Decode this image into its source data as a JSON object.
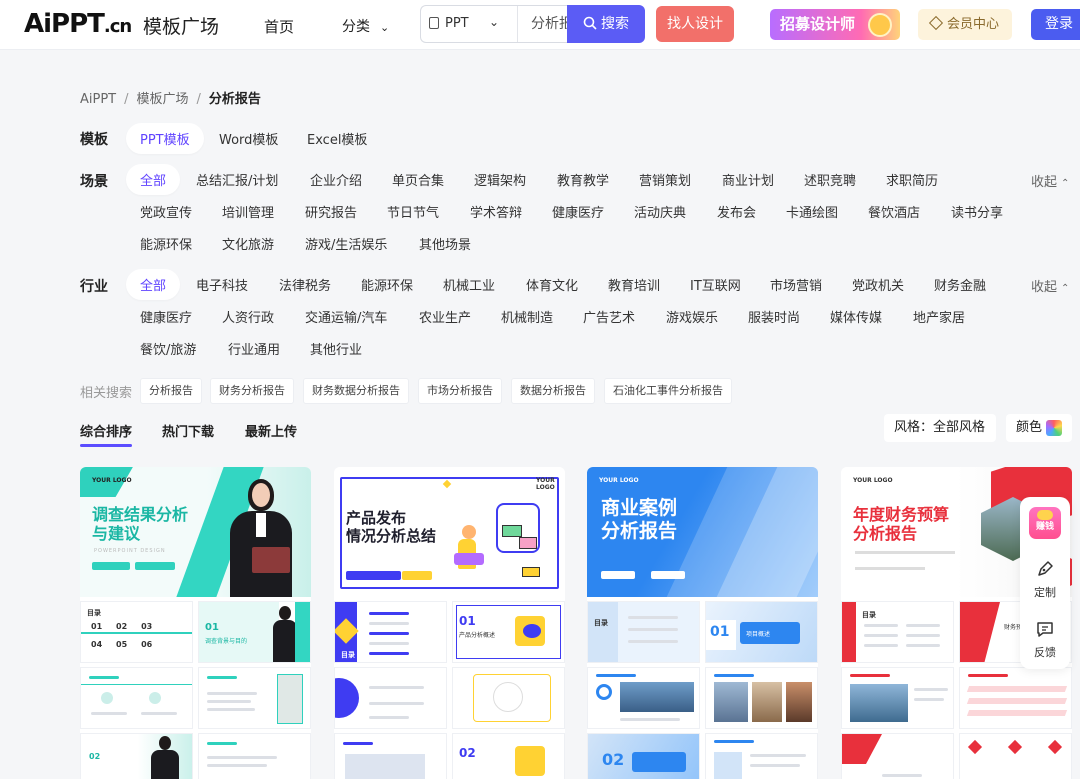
{
  "header": {
    "logo_main": "AiPPT",
    "logo_cn": ".cn",
    "logo_sub": "模板广场",
    "nav_home": "首页",
    "nav_category": "分类",
    "search_type": "PPT",
    "search_value": "分析报告",
    "search_button": "搜索",
    "designer_button": "找人设计",
    "recruit_button": "招募设计师",
    "member_button": "会员中心",
    "login_button": "登录"
  },
  "breadcrumb": [
    "AiPPT",
    "模板广场",
    "分析报告"
  ],
  "filters": {
    "template": {
      "label": "模板",
      "items": [
        "PPT模板",
        "Word模板",
        "Excel模板"
      ],
      "active": "PPT模板"
    },
    "scene": {
      "label": "场景",
      "collapse": "收起",
      "rows": [
        [
          "全部",
          "总结汇报/计划",
          "企业介绍",
          "单页合集",
          "逻辑架构",
          "教育教学",
          "营销策划",
          "商业计划",
          "述职竞聘",
          "求职简历"
        ],
        [
          "党政宣传",
          "培训管理",
          "研究报告",
          "节日节气",
          "学术答辩",
          "健康医疗",
          "活动庆典",
          "发布会",
          "卡通绘图",
          "餐饮酒店",
          "读书分享"
        ],
        [
          "能源环保",
          "文化旅游",
          "游戏/生活娱乐",
          "其他场景"
        ]
      ],
      "active": "全部"
    },
    "industry": {
      "label": "行业",
      "collapse": "收起",
      "rows": [
        [
          "全部",
          "电子科技",
          "法律税务",
          "能源环保",
          "机械工业",
          "体育文化",
          "教育培训",
          "IT互联网",
          "市场营销",
          "党政机关",
          "财务金融"
        ],
        [
          "健康医疗",
          "人资行政",
          "交通运输/汽车",
          "农业生产",
          "机械制造",
          "广告艺术",
          "游戏娱乐",
          "服装时尚",
          "媒体传媒",
          "地产家居"
        ],
        [
          "餐饮/旅游",
          "行业通用",
          "其他行业"
        ]
      ],
      "active": "全部"
    }
  },
  "related": {
    "label": "相关搜索",
    "items": [
      "分析报告",
      "财务分析报告",
      "财务数据分析报告",
      "市场分析报告",
      "数据分析报告",
      "石油化工事件分析报告"
    ]
  },
  "sort": {
    "tabs": [
      "综合排序",
      "热门下载",
      "最新上传"
    ],
    "active": "综合排序",
    "style_label": "风格：全部风格",
    "color_label": "颜色"
  },
  "cards": [
    {
      "cover_logo": "YOUR LOGO",
      "title_line1": "调查结果分析",
      "title_line2": "与建议",
      "subtitle": "POWERPOINT DESIGN",
      "thumb1_title": "目录",
      "thumb2_title": "调查背景与目的",
      "accent": "#20c3b0"
    },
    {
      "cover_logo": "YOUR LOGO",
      "title_line1": "产品发布",
      "title_line2": "情况分析总结",
      "subtitle": "",
      "thumb1_title": "目录",
      "thumb2_title": "产品分析概述",
      "accent": "#3f3cf2"
    },
    {
      "cover_logo": "YOUR LOGO",
      "title_line1": "商业案例",
      "title_line2": "分析报告",
      "subtitle": "",
      "thumb1_title": "目录",
      "thumb2_title": "项目概述",
      "accent": "#2d86f0"
    },
    {
      "cover_logo": "YOUR LOGO",
      "title_line1": "年度财务预算",
      "title_line2": "分析报告",
      "subtitle": "",
      "thumb1_title": "目录",
      "thumb2_title": "财务预算",
      "accent": "#e8303c"
    }
  ],
  "float_side": {
    "money_label": "赚钱",
    "custom_label": "定制",
    "feedback_label": "反馈"
  },
  "colors": {
    "primary": "#5b5cf5",
    "active_text": "#6044ff",
    "designer": "#f2706a",
    "login": "#4b5cf0"
  }
}
